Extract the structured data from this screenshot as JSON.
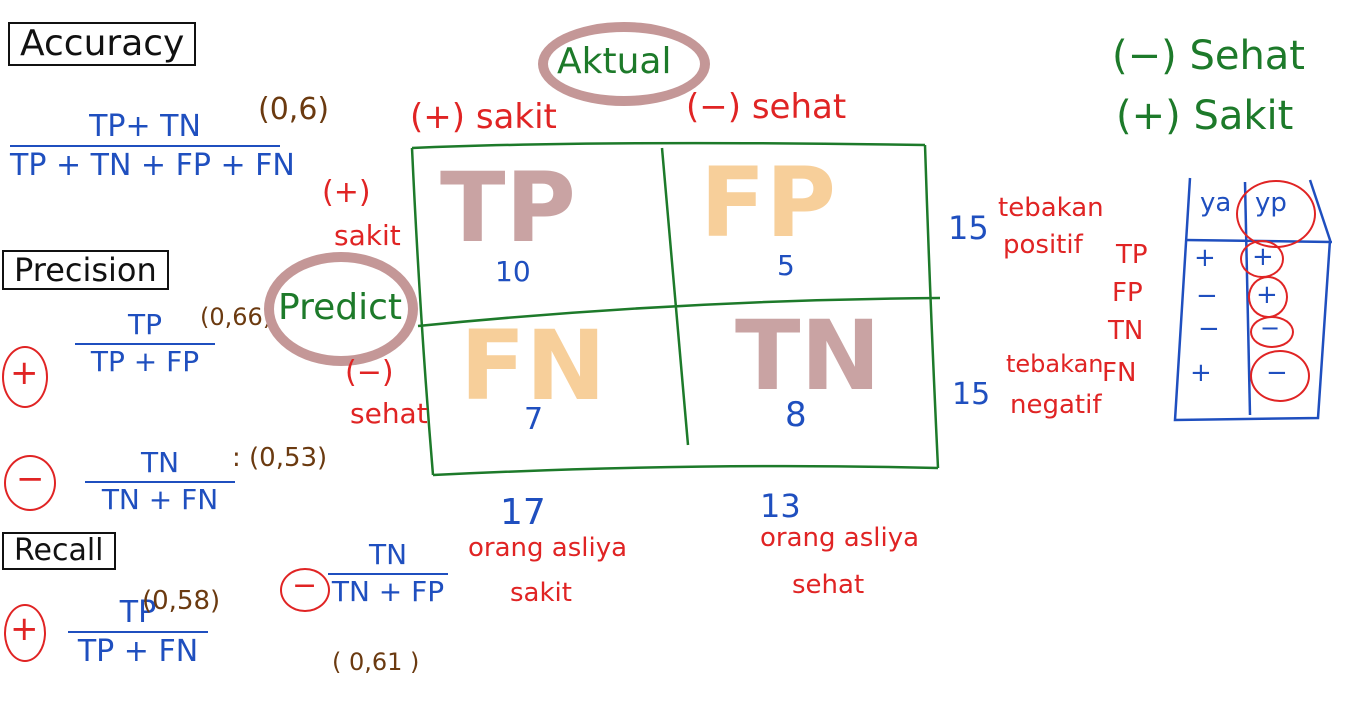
{
  "left": {
    "accuracy": {
      "title": "Accuracy",
      "num": "TP+ TN",
      "den": "TP + TN + FP + FN",
      "value": "(0,6)"
    },
    "precision": {
      "title": "Precision",
      "pos": {
        "sign": "+",
        "num": "TP",
        "den": "TP + FP",
        "value": "(0,66)"
      },
      "neg": {
        "sign": "−",
        "num": "TN",
        "den": "TN + FN",
        "value": ": (0,53)"
      }
    },
    "recall": {
      "title": "Recall",
      "pos": {
        "sign": "+",
        "num": "TP",
        "den": "TP + FN",
        "value": "(0,58)"
      },
      "neg": {
        "sign": "−",
        "num": "TN",
        "den": "TN + FP",
        "value": "( 0,61 )"
      }
    }
  },
  "matrix": {
    "actual_label": "Aktual",
    "actual_pos": "(+) sakit",
    "actual_neg": "(−) sehat",
    "predict_label": "Predict",
    "predict_pos": [
      "(+)",
      "sakit"
    ],
    "predict_neg": [
      "(−)",
      "sehat"
    ],
    "cells": {
      "tp": {
        "label": "TP",
        "count": "10"
      },
      "fp": {
        "label": "FP",
        "count": "5"
      },
      "fn": {
        "label": "FN",
        "count": "7"
      },
      "tn": {
        "label": "TN",
        "count": "8"
      }
    },
    "row_totals": [
      {
        "count": "15",
        "note": [
          "tebakan",
          "positif"
        ]
      },
      {
        "count": "15",
        "note": [
          "tebakan",
          "negatif"
        ]
      }
    ],
    "col_totals": [
      {
        "count": "17",
        "note": [
          "orang asliya",
          "sakit"
        ]
      },
      {
        "count": "13",
        "note": [
          "orang asliya",
          "sehat"
        ]
      }
    ]
  },
  "legend": {
    "neg": "(−) Sehat",
    "pos": "(+) Sakit"
  },
  "mini_labels": [
    "TP",
    "FP",
    "TN",
    "FN"
  ],
  "table": {
    "headers": [
      "ya",
      "yp"
    ],
    "rows": [
      [
        "+",
        "+"
      ],
      [
        "−",
        "+"
      ],
      [
        "−",
        "−"
      ],
      [
        "+",
        "−"
      ]
    ]
  },
  "colors": {
    "red": "#e02424",
    "green": "#1d7a2a",
    "blue": "#1f4fbf",
    "brown": "#6b3a10",
    "mauve": "#c49797",
    "orange": "#f7cf9a"
  }
}
